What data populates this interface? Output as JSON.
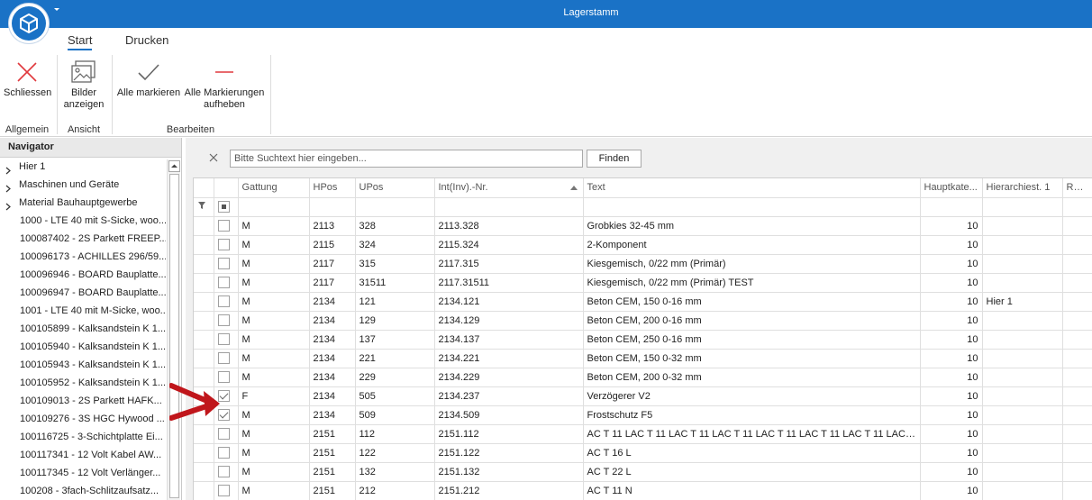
{
  "window": {
    "title": "Lagerstamm"
  },
  "ribbon": {
    "tabs": [
      {
        "label": "Start"
      },
      {
        "label": "Drucken"
      }
    ],
    "buttons": {
      "close": "Schliessen",
      "show_images": "Bilder anzeigen",
      "mark_all": "Alle markieren",
      "unmark_all": "Alle Markierungen aufheben"
    },
    "groups": {
      "general": "Allgemein",
      "view": "Ansicht",
      "edit": "Bearbeiten"
    }
  },
  "navigator": {
    "title": "Navigator",
    "items": [
      {
        "label": "Hier 1",
        "expandable": true
      },
      {
        "label": "Maschinen und Geräte",
        "expandable": true
      },
      {
        "label": "Material Bauhauptgewerbe",
        "expandable": true
      },
      {
        "label": "1000 - LTE 40 mit S-Sicke, woo...",
        "expandable": false
      },
      {
        "label": "100087402 - 2S Parkett FREEP...",
        "expandable": false
      },
      {
        "label": "100096173 - ACHILLES 296/59...",
        "expandable": false
      },
      {
        "label": "100096946 - BOARD Bauplatte...",
        "expandable": false
      },
      {
        "label": "100096947 - BOARD Bauplatte...",
        "expandable": false
      },
      {
        "label": "1001 - LTE 40 mit M-Sicke, woo...",
        "expandable": false
      },
      {
        "label": "100105899 - Kalksandstein K 1...",
        "expandable": false
      },
      {
        "label": "100105940 - Kalksandstein K 1...",
        "expandable": false
      },
      {
        "label": "100105943 - Kalksandstein K 1...",
        "expandable": false
      },
      {
        "label": "100105952 - Kalksandstein K 1...",
        "expandable": false
      },
      {
        "label": "100109013 - 2S Parkett HAFK...",
        "expandable": false
      },
      {
        "label": "100109276 - 3S HGC Hywood ...",
        "expandable": false
      },
      {
        "label": "100116725 - 3-Schichtplatte Ei...",
        "expandable": false
      },
      {
        "label": "100117341 - 12 Volt Kabel AW...",
        "expandable": false
      },
      {
        "label": "100117345 - 12 Volt Verlänger...",
        "expandable": false
      },
      {
        "label": "100208 - 3fach-Schlitzaufsatz...",
        "expandable": false
      }
    ]
  },
  "search": {
    "placeholder": "Bitte Suchtext hier eingeben...",
    "button": "Finden"
  },
  "grid": {
    "columns": [
      "Gattung",
      "HPos",
      "UPos",
      "Int(Inv).-Nr.",
      "Text",
      "Hauptkate...",
      "Hierarchiest. 1",
      "Rab..."
    ],
    "rows": [
      {
        "checked": false,
        "gattung": "M",
        "hpos": "2113",
        "upos": "328",
        "intnr": "2113.328",
        "text": "Grobkies 32-45 mm",
        "hauptkat": "10",
        "hier": "",
        "rab": ""
      },
      {
        "checked": false,
        "gattung": "M",
        "hpos": "2115",
        "upos": "324",
        "intnr": "2115.324",
        "text": "2-Komponent",
        "hauptkat": "10",
        "hier": "",
        "rab": ""
      },
      {
        "checked": false,
        "gattung": "M",
        "hpos": "2117",
        "upos": "315",
        "intnr": "2117.315",
        "text": "Kiesgemisch, 0/22 mm (Primär)",
        "hauptkat": "10",
        "hier": "",
        "rab": ""
      },
      {
        "checked": false,
        "gattung": "M",
        "hpos": "2117",
        "upos": "31511",
        "intnr": "2117.31511",
        "text": "Kiesgemisch, 0/22 mm (Primär) TEST",
        "hauptkat": "10",
        "hier": "",
        "rab": ""
      },
      {
        "checked": false,
        "gattung": "M",
        "hpos": "2134",
        "upos": "121",
        "intnr": "2134.121",
        "text": "Beton CEM, 150  0-16 mm",
        "hauptkat": "10",
        "hier": "Hier 1",
        "rab": ""
      },
      {
        "checked": false,
        "gattung": "M",
        "hpos": "2134",
        "upos": "129",
        "intnr": "2134.129",
        "text": "Beton CEM, 200  0-16 mm",
        "hauptkat": "10",
        "hier": "",
        "rab": ""
      },
      {
        "checked": false,
        "gattung": "M",
        "hpos": "2134",
        "upos": "137",
        "intnr": "2134.137",
        "text": "Beton CEM, 250  0-16 mm",
        "hauptkat": "10",
        "hier": "",
        "rab": ""
      },
      {
        "checked": false,
        "gattung": "M",
        "hpos": "2134",
        "upos": "221",
        "intnr": "2134.221",
        "text": "Beton CEM, 150  0-32 mm",
        "hauptkat": "10",
        "hier": "",
        "rab": ""
      },
      {
        "checked": false,
        "gattung": "M",
        "hpos": "2134",
        "upos": "229",
        "intnr": "2134.229",
        "text": "Beton CEM, 200  0-32 mm",
        "hauptkat": "10",
        "hier": "",
        "rab": ""
      },
      {
        "checked": true,
        "gattung": "F",
        "hpos": "2134",
        "upos": "505",
        "intnr": "2134.237",
        "text": "Verzögerer V2",
        "hauptkat": "10",
        "hier": "",
        "rab": ""
      },
      {
        "checked": true,
        "gattung": "M",
        "hpos": "2134",
        "upos": "509",
        "intnr": "2134.509",
        "text": "Frostschutz F5",
        "hauptkat": "10",
        "hier": "",
        "rab": ""
      },
      {
        "checked": false,
        "gattung": "M",
        "hpos": "2151",
        "upos": "112",
        "intnr": "2151.112",
        "text": "AC T 11 LAC T 11 LAC T 11 LAC T 11 LAC T 11 LAC T 11 LAC T 11 LAC T 1...",
        "hauptkat": "10",
        "hier": "",
        "rab": ""
      },
      {
        "checked": false,
        "gattung": "M",
        "hpos": "2151",
        "upos": "122",
        "intnr": "2151.122",
        "text": "AC T 16 L",
        "hauptkat": "10",
        "hier": "",
        "rab": ""
      },
      {
        "checked": false,
        "gattung": "M",
        "hpos": "2151",
        "upos": "132",
        "intnr": "2151.132",
        "text": "AC T 22 L",
        "hauptkat": "10",
        "hier": "",
        "rab": ""
      },
      {
        "checked": false,
        "gattung": "M",
        "hpos": "2151",
        "upos": "212",
        "intnr": "2151.212",
        "text": "AC T 11 N",
        "hauptkat": "10",
        "hier": "",
        "rab": ""
      }
    ]
  },
  "colors": {
    "accent": "#1a72c6",
    "close_icon": "#e0393e",
    "annotation_arrow": "#c0161b"
  }
}
